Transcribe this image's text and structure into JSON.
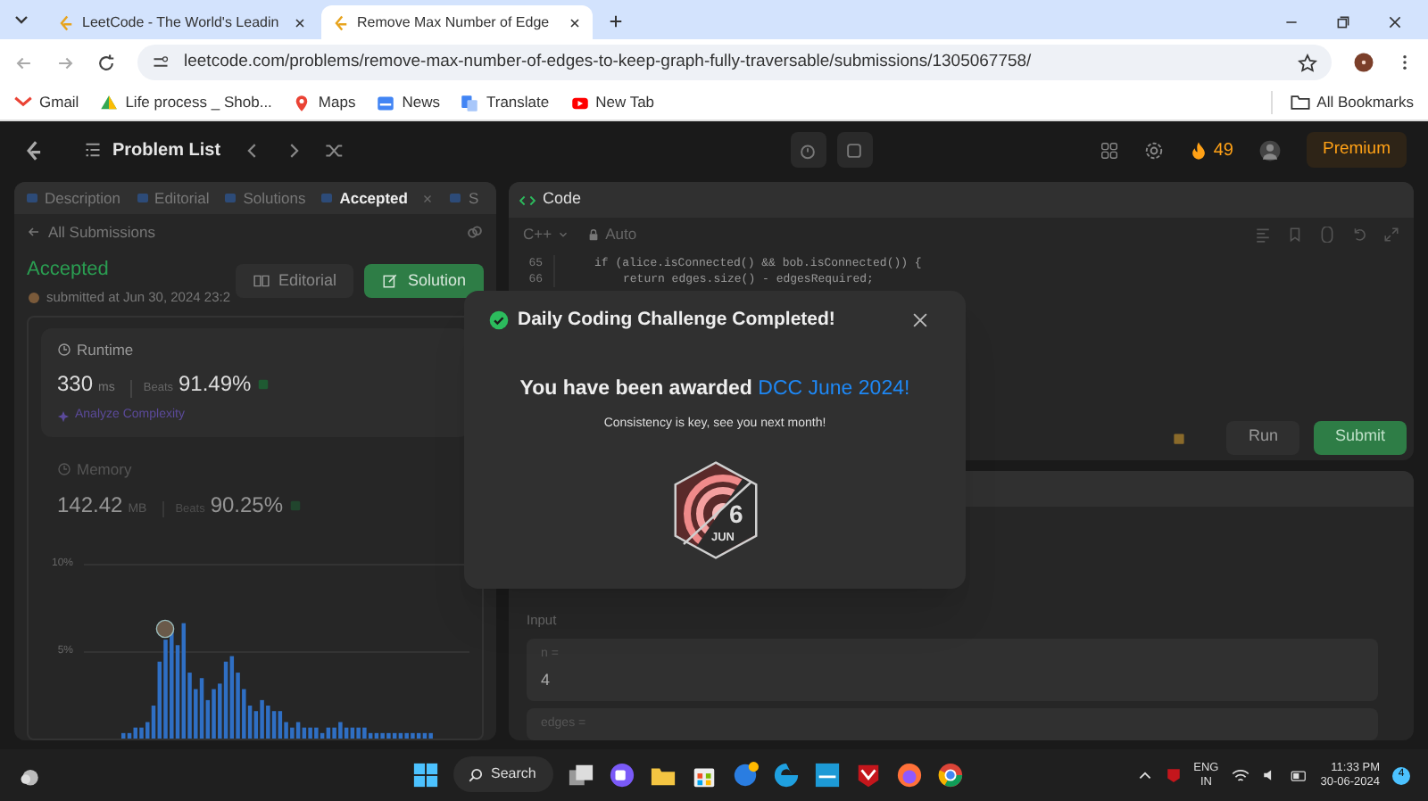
{
  "browser": {
    "tabs": [
      {
        "title": "LeetCode - The World's Leadin",
        "selected": false
      },
      {
        "title": "Remove Max Number of Edge",
        "selected": true
      }
    ],
    "url": "leetcode.com/problems/remove-max-number-of-edges-to-keep-graph-fully-traversable/submissions/1305067758/",
    "bookmarks": [
      "Gmail",
      "Life process _ Shob...",
      "Maps",
      "News",
      "Translate",
      "New Tab"
    ],
    "all_bookmarks": "All Bookmarks"
  },
  "nav": {
    "title": "Problem List",
    "streak": "49",
    "premium": "Premium"
  },
  "left_panel": {
    "tabs": [
      {
        "label": "Description",
        "selected": false
      },
      {
        "label": "Editorial",
        "selected": false
      },
      {
        "label": "Solutions",
        "selected": false
      },
      {
        "label": "Accepted",
        "selected": true
      },
      {
        "label": "S",
        "selected": false
      }
    ],
    "back": "All Submissions",
    "status": "Accepted",
    "submitted": "submitted at Jun 30, 2024 23:2",
    "buttons": [
      "Editorial",
      "Solution"
    ],
    "runtime": {
      "label": "Runtime",
      "value": "330",
      "unit": "ms",
      "beats": "Beats",
      "percent": "91.49%",
      "link": "Analyze Complexity"
    },
    "memory": {
      "label": "Memory",
      "value": "142.42",
      "unit": "MB",
      "beats": "Beats",
      "percent": "90.25%"
    },
    "axis_labels": [
      "10%",
      "5%"
    ]
  },
  "code_panel": {
    "title": "Code",
    "language": "C++",
    "mode": "Auto",
    "lines": [
      {
        "number": "65",
        "text": "if (alice.isConnected() && bob.isConnected()) {",
        "children": [
          {
            "number": "66",
            "text": "return edges.size() - edgesRequired;"
          }
        ]
      }
    ],
    "run": "Run",
    "submit": "Submit"
  },
  "testcase": {
    "input_label": "Input",
    "fields": [
      {
        "name": "n =",
        "value": "4"
      },
      {
        "name": "edges ="
      }
    ]
  },
  "modal": {
    "title": "Daily Coding Challenge Completed!",
    "message": "You have been awarded ",
    "award": "DCC June 2024!",
    "subtitle": "Consistency is key, see you next month!",
    "badge_day": "6",
    "badge_month": "JUN"
  },
  "taskbar": {
    "search": "Search",
    "language": "ENG",
    "region": "IN",
    "time": "11:33 PM",
    "date": "30-06-2024",
    "notifications": "4"
  }
}
